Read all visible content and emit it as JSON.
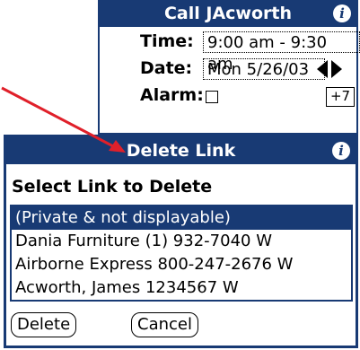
{
  "call_form": {
    "title": "Call JAcworth",
    "time_label": "Time:",
    "time_value": "9:00 am - 9:30 am",
    "date_label": "Date:",
    "date_value": "Mon 5/26/03",
    "alarm_label": "Alarm:",
    "alarm_offset": "+7"
  },
  "dialog": {
    "title": "Delete Link",
    "prompt": "Select Link to Delete",
    "links": [
      "(Private & not displayable)",
      "Dania Furniture (1) 932-7040 W",
      "Airborne Express 800-247-2676 W",
      "Acworth, James 1234567 W"
    ],
    "selected_index": 0,
    "delete_label": "Delete",
    "cancel_label": "Cancel"
  },
  "colors": {
    "titlebar": "#183a74",
    "annotation_arrow": "#e0202a"
  },
  "icons": [
    "info-icon",
    "checkbox",
    "arrow-left-icon",
    "arrow-right-icon"
  ]
}
